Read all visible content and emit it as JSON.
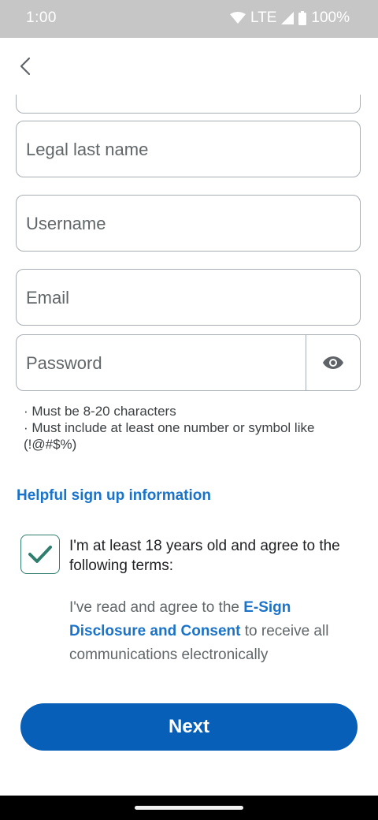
{
  "status_bar": {
    "time": "1:00",
    "network": "LTE",
    "battery": "100%",
    "icons": [
      "wifi-icon",
      "cell-signal-icon",
      "battery-icon"
    ]
  },
  "app_bar": {
    "back_icon": "chevron-left-icon"
  },
  "form": {
    "legal_last_name": {
      "placeholder": "Legal last name",
      "value": ""
    },
    "username": {
      "placeholder": "Username",
      "value": ""
    },
    "email": {
      "placeholder": "Email",
      "value": ""
    },
    "password": {
      "placeholder": "Password",
      "value": "",
      "toggle_icon": "eye-icon"
    },
    "password_hints": [
      "· Must be 8-20 characters",
      "· Must include at least one number or symbol like (!@#$%)"
    ]
  },
  "helpful_link": "Helpful sign up information",
  "agreement": {
    "checked": true,
    "label": "I'm at least 18 years old and agree to the following terms:",
    "terms_prefix": "I've read and agree to the ",
    "terms_link": "E-Sign Disclosure and Consent",
    "terms_suffix": " to receive all communications electronically"
  },
  "next_button": "Next",
  "colors": {
    "primary_button": "#075fb7",
    "link": "#1a73c9",
    "checkbox_check": "#2e7d6d",
    "status_bar": "#c6c6c6"
  }
}
